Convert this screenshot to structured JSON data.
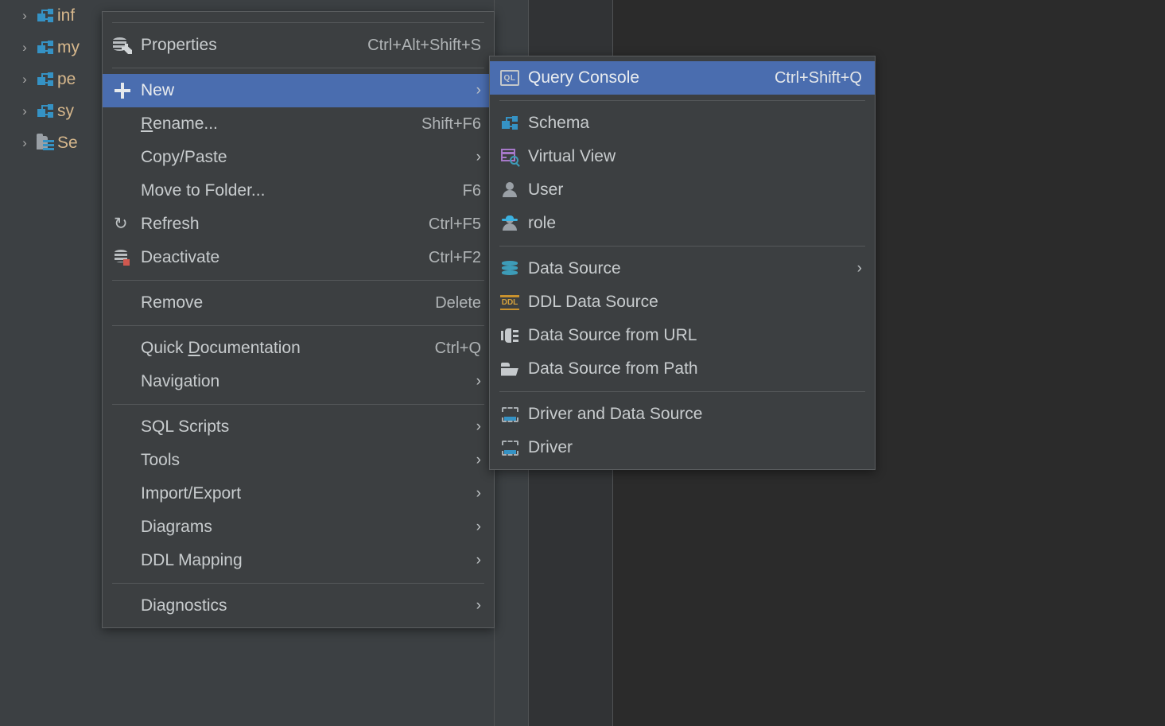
{
  "background": {
    "colors": {
      "window": "#3c4043",
      "panel_mid": "#3c4043",
      "panel_editor": "#313335",
      "panel_right": "#2b2b2b",
      "menu": "#3c3f41",
      "menu_border": "#5a5d5f",
      "selection": "#4a6daf",
      "text": "#c8ccce",
      "accent_text": "#d6b78c"
    }
  },
  "tree": {
    "items": [
      {
        "label": "inf",
        "icon": "schema-icon",
        "arrow": "›"
      },
      {
        "label": "my",
        "icon": "schema-icon",
        "arrow": "›"
      },
      {
        "label": "pe",
        "icon": "schema-icon",
        "arrow": "›"
      },
      {
        "label": "sy",
        "icon": "schema-icon",
        "arrow": "›"
      },
      {
        "label": "Se",
        "icon": "server-icon",
        "arrow": "›"
      }
    ]
  },
  "context_menu": {
    "items": [
      {
        "type": "separator"
      },
      {
        "type": "item",
        "id": "properties",
        "label": "Properties",
        "accel": "Ctrl+Alt+Shift+S",
        "icon": "database-properties-icon",
        "arrow": "",
        "selected": false
      },
      {
        "type": "separator"
      },
      {
        "type": "item",
        "id": "new",
        "label": "New",
        "accel": "",
        "icon": "plus-icon",
        "arrow": "›",
        "selected": true
      },
      {
        "type": "item",
        "id": "rename",
        "label": "Rename...",
        "mnemonic": "R",
        "accel": "Shift+F6",
        "icon": "",
        "arrow": "",
        "selected": false
      },
      {
        "type": "item",
        "id": "copy-paste",
        "label": "Copy/Paste",
        "accel": "",
        "icon": "",
        "arrow": "›",
        "selected": false
      },
      {
        "type": "item",
        "id": "move-to-folder",
        "label": "Move to Folder...",
        "accel": "F6",
        "icon": "",
        "arrow": "",
        "selected": false
      },
      {
        "type": "item",
        "id": "refresh",
        "label": "Refresh",
        "accel": "Ctrl+F5",
        "icon": "refresh-icon",
        "arrow": "",
        "selected": false
      },
      {
        "type": "item",
        "id": "deactivate",
        "label": "Deactivate",
        "accel": "Ctrl+F2",
        "icon": "deactivate-icon",
        "arrow": "",
        "selected": false
      },
      {
        "type": "separator"
      },
      {
        "type": "item",
        "id": "remove",
        "label": "Remove",
        "accel": "Delete",
        "icon": "",
        "arrow": "",
        "selected": false
      },
      {
        "type": "separator"
      },
      {
        "type": "item",
        "id": "quick-documentation",
        "label": "Quick Documentation",
        "mnemonic": "D",
        "accel": "Ctrl+Q",
        "icon": "",
        "arrow": "",
        "selected": false
      },
      {
        "type": "item",
        "id": "navigation",
        "label": "Navigation",
        "accel": "",
        "icon": "",
        "arrow": "›",
        "selected": false
      },
      {
        "type": "separator"
      },
      {
        "type": "item",
        "id": "sql-scripts",
        "label": "SQL Scripts",
        "accel": "",
        "icon": "",
        "arrow": "›",
        "selected": false
      },
      {
        "type": "item",
        "id": "tools",
        "label": "Tools",
        "accel": "",
        "icon": "",
        "arrow": "›",
        "selected": false
      },
      {
        "type": "item",
        "id": "import-export",
        "label": "Import/Export",
        "accel": "",
        "icon": "",
        "arrow": "›",
        "selected": false
      },
      {
        "type": "item",
        "id": "diagrams",
        "label": "Diagrams",
        "accel": "",
        "icon": "",
        "arrow": "›",
        "selected": false
      },
      {
        "type": "item",
        "id": "ddl-mapping",
        "label": "DDL Mapping",
        "accel": "",
        "icon": "",
        "arrow": "›",
        "selected": false
      },
      {
        "type": "separator"
      },
      {
        "type": "item",
        "id": "diagnostics",
        "label": "Diagnostics",
        "accel": "",
        "icon": "",
        "arrow": "›",
        "selected": false
      }
    ]
  },
  "new_submenu": {
    "items": [
      {
        "type": "item",
        "id": "query-console",
        "label": "Query Console",
        "accel": "Ctrl+Shift+Q",
        "icon": "query-console-icon",
        "arrow": "",
        "selected": true
      },
      {
        "type": "separator"
      },
      {
        "type": "item",
        "id": "schema",
        "label": "Schema",
        "accel": "",
        "icon": "schema-icon",
        "arrow": "",
        "selected": false
      },
      {
        "type": "item",
        "id": "virtual-view",
        "label": "Virtual View",
        "accel": "",
        "icon": "virtual-view-icon",
        "arrow": "",
        "selected": false
      },
      {
        "type": "item",
        "id": "user",
        "label": "User",
        "accel": "",
        "icon": "user-icon",
        "arrow": "",
        "selected": false
      },
      {
        "type": "item",
        "id": "role",
        "label": "role",
        "accel": "",
        "icon": "role-icon",
        "arrow": "",
        "selected": false
      },
      {
        "type": "separator"
      },
      {
        "type": "item",
        "id": "data-source",
        "label": "Data Source",
        "accel": "",
        "icon": "data-source-icon",
        "arrow": "›",
        "selected": false
      },
      {
        "type": "item",
        "id": "ddl-data-source",
        "label": "DDL Data Source",
        "accel": "",
        "icon": "ddl-icon",
        "arrow": "",
        "selected": false
      },
      {
        "type": "item",
        "id": "data-source-from-url",
        "label": "Data Source from URL",
        "accel": "",
        "icon": "url-icon",
        "arrow": "",
        "selected": false
      },
      {
        "type": "item",
        "id": "data-source-from-path",
        "label": "Data Source from Path",
        "accel": "",
        "icon": "folder-icon",
        "arrow": "",
        "selected": false
      },
      {
        "type": "separator"
      },
      {
        "type": "item",
        "id": "driver-and-data-source",
        "label": "Driver and Data Source",
        "accel": "",
        "icon": "driver-icon",
        "arrow": "",
        "selected": false
      },
      {
        "type": "item",
        "id": "driver",
        "label": "Driver",
        "accel": "",
        "icon": "driver-icon",
        "arrow": "",
        "selected": false
      }
    ]
  }
}
